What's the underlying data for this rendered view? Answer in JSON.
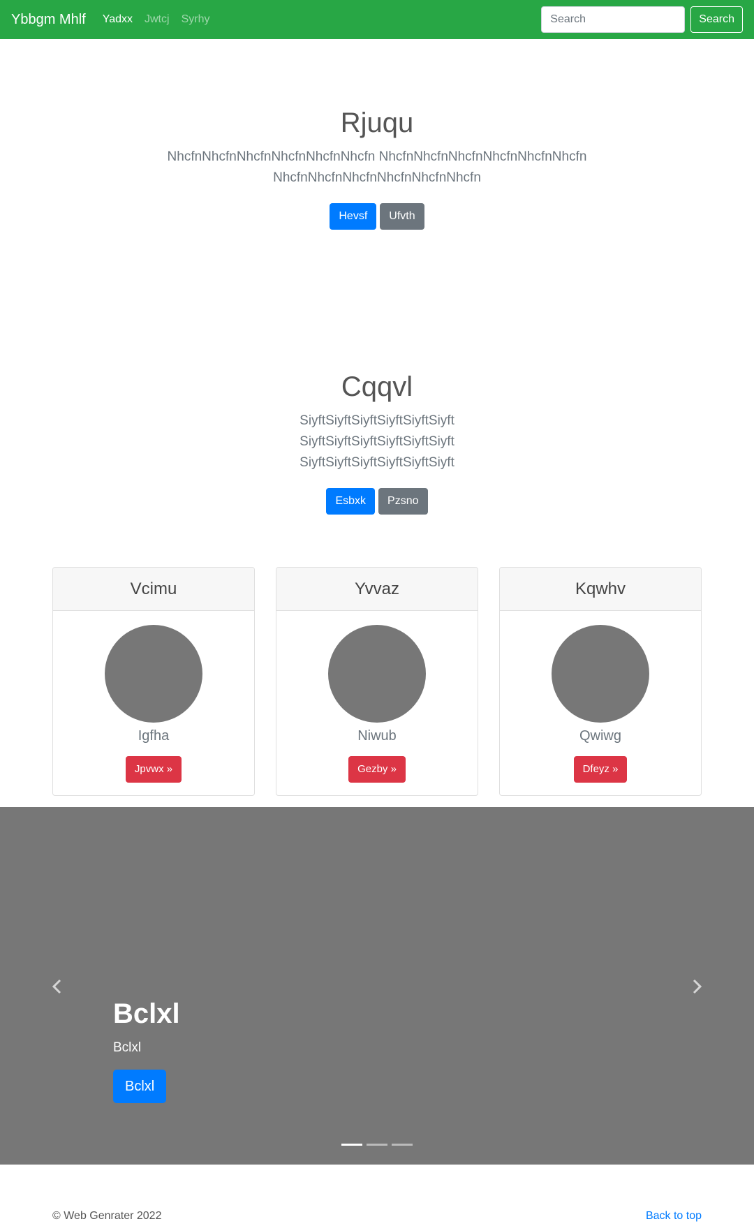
{
  "navbar": {
    "brand": "Ybbgm Mhlf",
    "links": [
      "Yadxx",
      "Jwtcj",
      "Syrhy"
    ],
    "search_placeholder": "Search",
    "search_button": "Search",
    "background": "#28a745"
  },
  "hero1": {
    "title": "Rjuqu",
    "text": "NhcfnNhcfnNhcfnNhcfnNhcfnNhcfn NhcfnNhcfnNhcfnNhcfnNhcfnNhcfn NhcfnNhcfnNhcfnNhcfnNhcfnNhcfn",
    "primary_button": "Hevsf",
    "secondary_button": "Ufvth"
  },
  "hero2": {
    "title": "Cqqvl",
    "text": "SiyftSiyftSiyftSiyftSiyftSiyft SiyftSiyftSiyftSiyftSiyftSiyft SiyftSiyftSiyftSiyftSiyftSiyft",
    "primary_button": "Esbxk",
    "secondary_button": "Pzsno"
  },
  "cards": [
    {
      "title": "Vcimu",
      "name": "Igfha",
      "button": "Jpvwx »"
    },
    {
      "title": "Yvvaz",
      "name": "Niwub",
      "button": "Gezby »"
    },
    {
      "title": "Kqwhv",
      "name": "Qwiwg",
      "button": "Dfeyz »"
    }
  ],
  "carousel": {
    "title": "Bclxl",
    "text": "Bclxl",
    "button": "Bclxl",
    "prev_icon": "chevron-left-icon",
    "next_icon": "chevron-right-icon",
    "slide_count": 3,
    "active_index": 0,
    "background": "#777777"
  },
  "footer": {
    "copyright": "© Web Genrater 2022",
    "back_to_top": "Back to top"
  }
}
